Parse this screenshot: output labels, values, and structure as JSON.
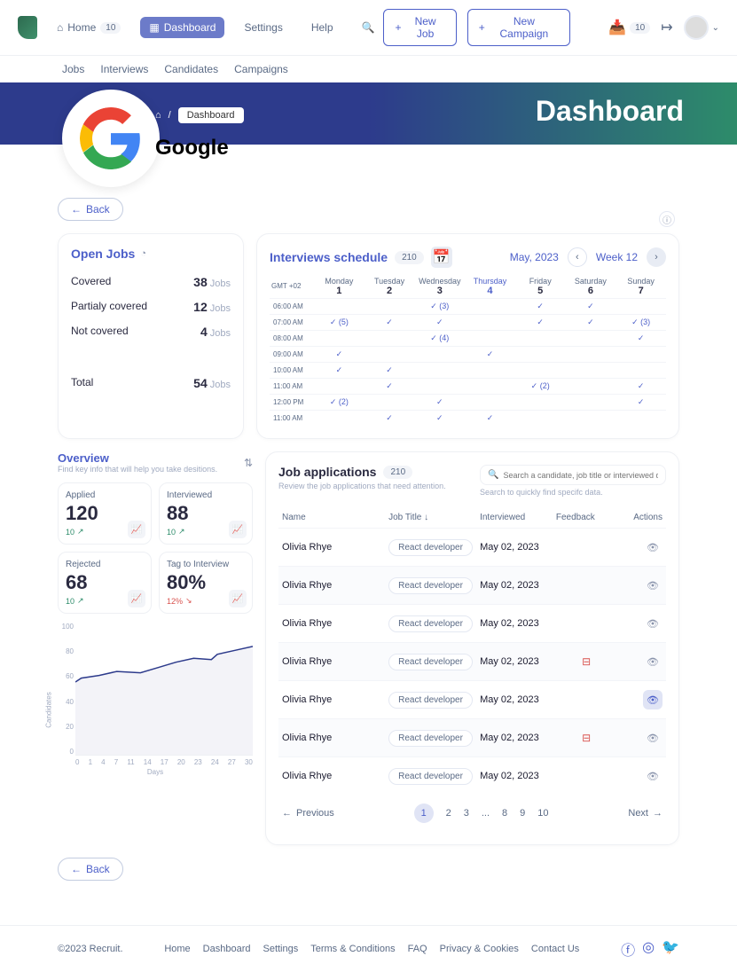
{
  "header": {
    "home": "Home",
    "home_badge": "10",
    "dashboard": "Dashboard",
    "settings": "Settings",
    "help": "Help",
    "new_job": "New Job",
    "new_campaign": "New Campaign",
    "inbox_badge": "10"
  },
  "subnav": {
    "jobs": "Jobs",
    "interviews": "Interviews",
    "candidates": "Candidates",
    "campaigns": "Campaigns"
  },
  "hero": {
    "title": "Dashboard",
    "company": "Google",
    "breadcrumb_current": "Dashboard"
  },
  "back": "Back",
  "open_jobs": {
    "title": "Open Jobs",
    "rows": [
      {
        "label": "Covered",
        "num": "38",
        "unit": "Jobs"
      },
      {
        "label": "Partialy covered",
        "num": "12",
        "unit": "Jobs"
      },
      {
        "label": "Not covered",
        "num": "4",
        "unit": "Jobs"
      }
    ],
    "total": {
      "label": "Total",
      "num": "54",
      "unit": "Jobs"
    }
  },
  "schedule": {
    "title": "Interviews schedule",
    "count": "210",
    "month": "May, 2023",
    "week": "Week 12",
    "tz": "GMT +02",
    "days": [
      {
        "name": "Monday",
        "num": "1"
      },
      {
        "name": "Tuesday",
        "num": "2"
      },
      {
        "name": "Wednesday",
        "num": "3"
      },
      {
        "name": "Thursday",
        "num": "4",
        "highlight": true
      },
      {
        "name": "Friday",
        "num": "5"
      },
      {
        "name": "Saturday",
        "num": "6"
      },
      {
        "name": "Sunday",
        "num": "7"
      }
    ],
    "slots": [
      {
        "t": "06:00 AM",
        "cells": [
          "",
          "",
          "(3)",
          "",
          "✓",
          "✓",
          ""
        ]
      },
      {
        "t": "07:00 AM",
        "cells": [
          "(5)",
          "✓",
          "✓",
          "",
          "✓",
          "✓",
          "(3)"
        ]
      },
      {
        "t": "08:00 AM",
        "cells": [
          "",
          "",
          "(4)",
          "",
          "",
          "",
          "✓"
        ]
      },
      {
        "t": "09:00 AM",
        "cells": [
          "✓",
          "",
          "",
          "✓",
          "",
          "",
          ""
        ]
      },
      {
        "t": "10:00 AM",
        "cells": [
          "✓",
          "✓",
          "",
          "",
          "",
          "",
          ""
        ]
      },
      {
        "t": "11:00 AM",
        "cells": [
          "",
          "✓",
          "",
          "",
          "(2)",
          "",
          "✓"
        ]
      },
      {
        "t": "12:00 PM",
        "cells": [
          "(2)",
          "",
          "✓",
          "",
          "",
          "",
          "✓"
        ]
      },
      {
        "t": "11:00 AM",
        "cells": [
          "",
          "✓",
          "✓",
          "✓",
          "",
          "",
          ""
        ]
      }
    ]
  },
  "overview": {
    "title": "Overview",
    "sub": "Find key info that will help you take desitions.",
    "stats": [
      {
        "label": "Applied",
        "val": "120",
        "delta": "10",
        "dir": "up"
      },
      {
        "label": "Interviewed",
        "val": "88",
        "delta": "10",
        "dir": "up"
      },
      {
        "label": "Rejected",
        "val": "68",
        "delta": "10",
        "dir": "up"
      },
      {
        "label": "Tag to Interview",
        "val": "80%",
        "delta": "12%",
        "dir": "down"
      }
    ]
  },
  "chart_data": {
    "type": "line",
    "title": "",
    "xlabel": "Days",
    "ylabel": "Candidates",
    "x": [
      0,
      1,
      4,
      7,
      11,
      14,
      17,
      20,
      23,
      24,
      27,
      30
    ],
    "y": [
      55,
      58,
      60,
      63,
      62,
      66,
      70,
      73,
      72,
      76,
      79,
      82
    ],
    "ylim": [
      0,
      100
    ],
    "yticks": [
      0,
      20,
      40,
      60,
      80,
      100
    ],
    "xticks": [
      0,
      1,
      4,
      7,
      11,
      14,
      17,
      20,
      23,
      24,
      27,
      30
    ]
  },
  "apps": {
    "title": "Job applications",
    "count": "210",
    "sub": "Review the job applications that need attention.",
    "search_placeholder": "Search a candidate, job title or interviewed date.",
    "search_hint": "Search to quickly find specifc data.",
    "cols": {
      "name": "Name",
      "job": "Job Title",
      "interviewed": "Interviewed",
      "feedback": "Feedback",
      "actions": "Actions"
    },
    "rows": [
      {
        "name": "Olivia Rhye",
        "job": "React developer",
        "date": "May 02, 2023",
        "fb": false,
        "hl": false
      },
      {
        "name": "Olivia Rhye",
        "job": "React developer",
        "date": "May 02, 2023",
        "fb": false,
        "hl": false
      },
      {
        "name": "Olivia Rhye",
        "job": "React developer",
        "date": "May 02, 2023",
        "fb": false,
        "hl": false
      },
      {
        "name": "Olivia Rhye",
        "job": "React developer",
        "date": "May 02, 2023",
        "fb": true,
        "hl": false
      },
      {
        "name": "Olivia Rhye",
        "job": "React developer",
        "date": "May 02, 2023",
        "fb": false,
        "hl": true
      },
      {
        "name": "Olivia Rhye",
        "job": "React developer",
        "date": "May 02, 2023",
        "fb": true,
        "hl": false
      },
      {
        "name": "Olivia Rhye",
        "job": "React developer",
        "date": "May 02, 2023",
        "fb": false,
        "hl": false
      }
    ]
  },
  "pagination": {
    "prev": "Previous",
    "next": "Next",
    "pages": [
      "1",
      "2",
      "3",
      "...",
      "8",
      "9",
      "10"
    ]
  },
  "footer": {
    "copy": "©2023 Recruit.",
    "links": [
      "Home",
      "Dashboard",
      "Settings",
      "Terms & Conditions",
      "FAQ",
      "Privacy & Cookies",
      "Contact Us"
    ]
  }
}
